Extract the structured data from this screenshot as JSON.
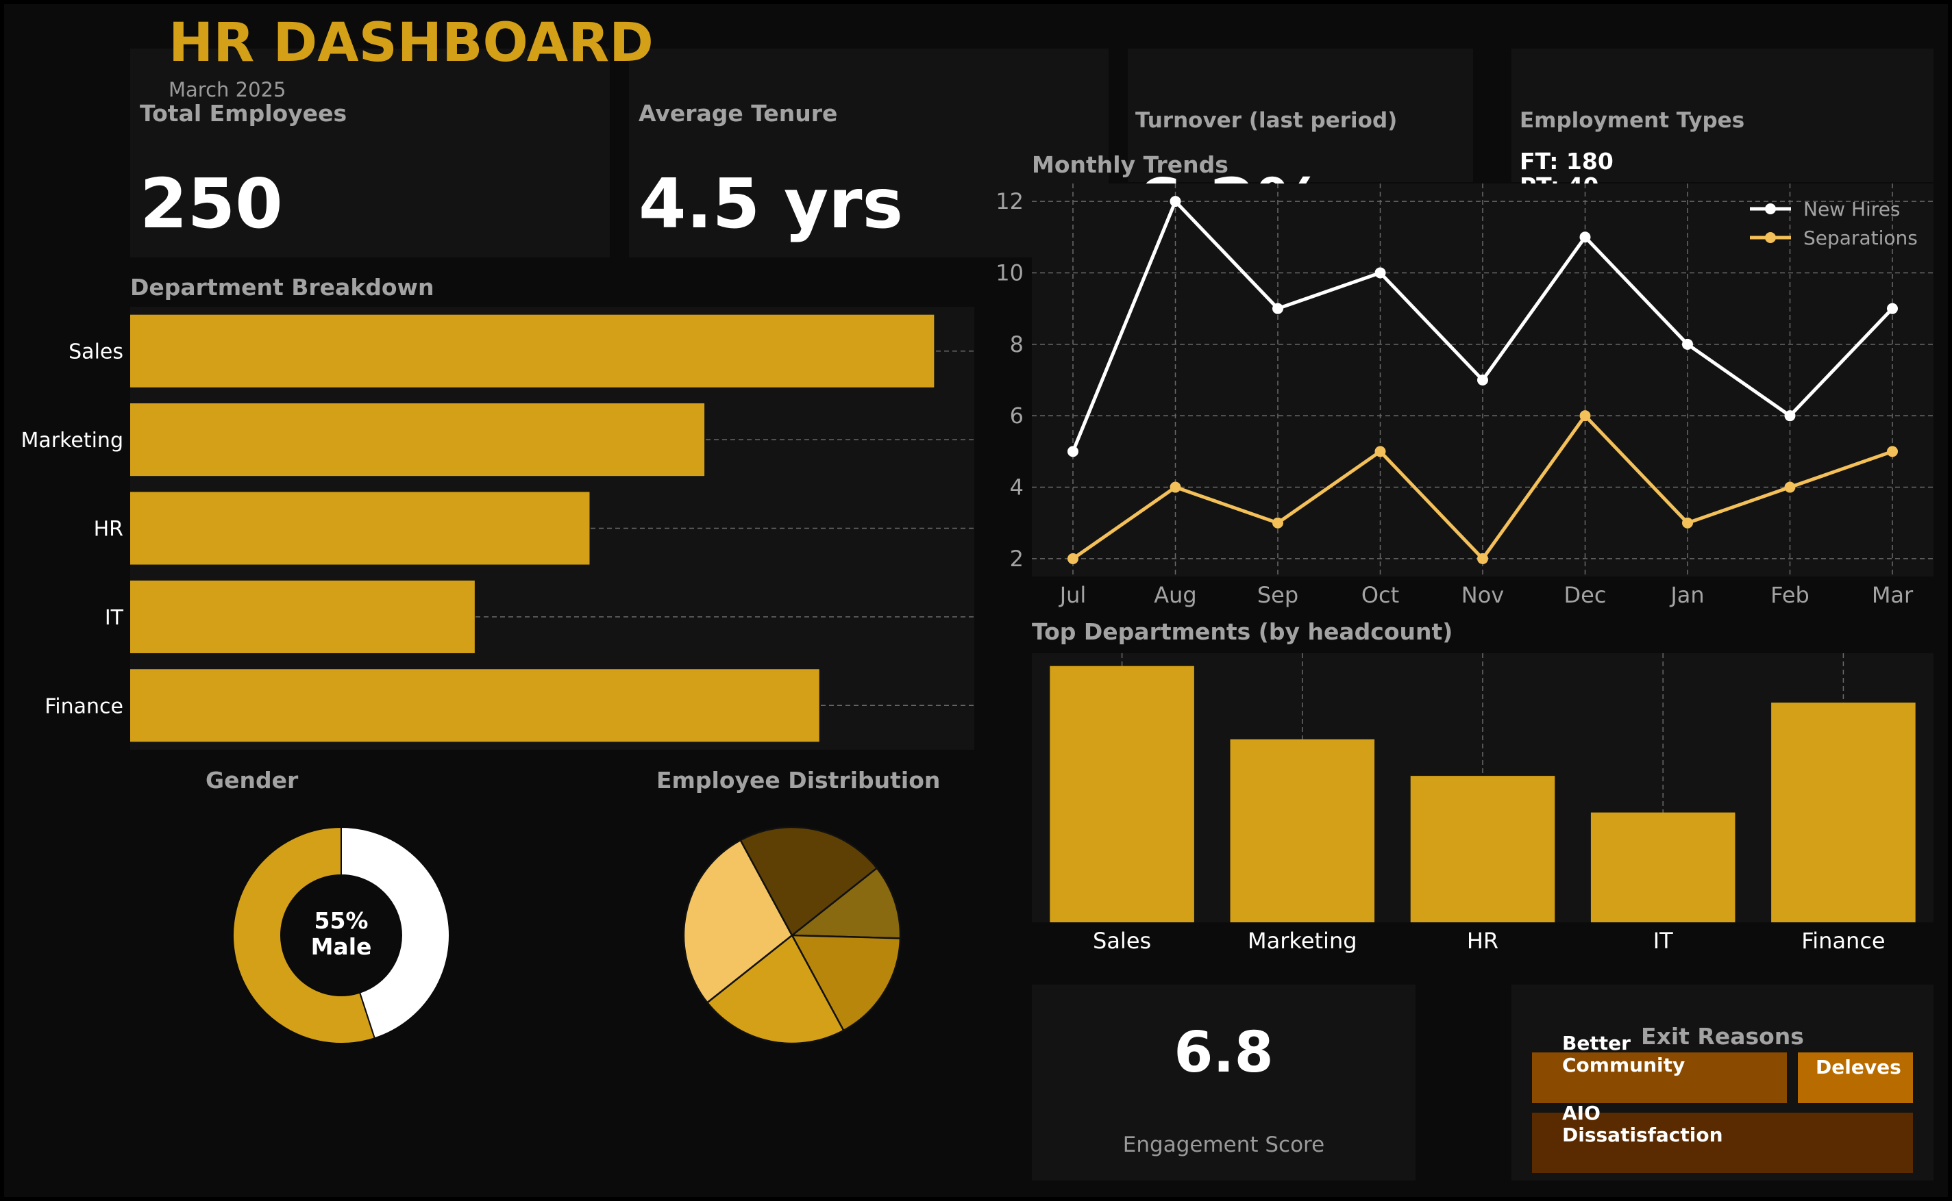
{
  "header": {
    "title": "HR DASHBOARD",
    "subtitle": "March 2025",
    "accent": "#d4a017"
  },
  "kpis": {
    "total_employees": {
      "label": "Total Employees",
      "value": "250"
    },
    "average_tenure": {
      "label": "Average Tenure",
      "value": "4.5 yrs"
    },
    "turnover": {
      "label": "Turnover (last period)",
      "value": "6.2%"
    },
    "employment_types": {
      "label": "Employment Types",
      "ft": "FT: 180",
      "pt": "PT: 40"
    },
    "engagement": {
      "value": "6.8",
      "label": "Engagement Score"
    }
  },
  "colors": {
    "bar": "#d4a017",
    "panel": "#131313",
    "background": "#0b0b0b",
    "separations": "#f4c05a",
    "new_hires": "#ffffff"
  },
  "chart_data": [
    {
      "id": "department_breakdown",
      "type": "bar",
      "orientation": "horizontal",
      "title": "Department Breakdown",
      "categories": [
        "Sales",
        "Marketing",
        "HR",
        "IT",
        "Finance"
      ],
      "values": [
        70,
        50,
        40,
        30,
        60
      ],
      "xlim": [
        0,
        73.5
      ],
      "grid": true
    },
    {
      "id": "monthly_trends",
      "type": "line",
      "title": "Monthly Trends",
      "x": [
        "Jul",
        "Aug",
        "Sep",
        "Oct",
        "Nov",
        "Dec",
        "Jan",
        "Feb",
        "Mar"
      ],
      "series": [
        {
          "name": "New Hires",
          "values": [
            5,
            12,
            9,
            10,
            7,
            11,
            8,
            6,
            9
          ]
        },
        {
          "name": "Separations",
          "values": [
            2,
            4,
            3,
            5,
            2,
            6,
            3,
            4,
            5
          ]
        }
      ],
      "yticks": [
        2,
        4,
        6,
        8,
        10,
        12
      ],
      "ylim": [
        1.5,
        12.5
      ],
      "legend": "top-right",
      "grid": true
    },
    {
      "id": "top_departments",
      "type": "bar",
      "title": "Top Departments (by headcount)",
      "categories": [
        "Sales",
        "Marketing",
        "HR",
        "IT",
        "Finance"
      ],
      "values": [
        70,
        50,
        40,
        30,
        60
      ],
      "ylim": [
        0,
        73.5
      ],
      "grid": true
    },
    {
      "id": "gender",
      "type": "pie",
      "style": "donut",
      "title": "Gender",
      "center_label": [
        "55%",
        "Male"
      ],
      "slices": [
        {
          "value": 55,
          "color": "#d4a017"
        },
        {
          "value": 45,
          "color": "#ffffff"
        }
      ]
    },
    {
      "id": "employee_distribution",
      "type": "pie",
      "title": "Employee Distribution",
      "slices": [
        {
          "value": 10,
          "color": "#8a6a10"
        },
        {
          "value": 15,
          "color": "#b8860b"
        },
        {
          "value": 20,
          "color": "#d4a017"
        },
        {
          "value": 25,
          "color": "#f4c463"
        },
        {
          "value": 20,
          "color": "#5e4005"
        }
      ]
    }
  ],
  "exit_reasons": {
    "title": "Exit Reasons",
    "items": [
      {
        "label": "Better Community",
        "color": "#8a4a00"
      },
      {
        "label": "Deleves",
        "color": "#b86c00"
      },
      {
        "label": "AIO Dissatisfaction",
        "color": "#5a2a00"
      }
    ]
  }
}
